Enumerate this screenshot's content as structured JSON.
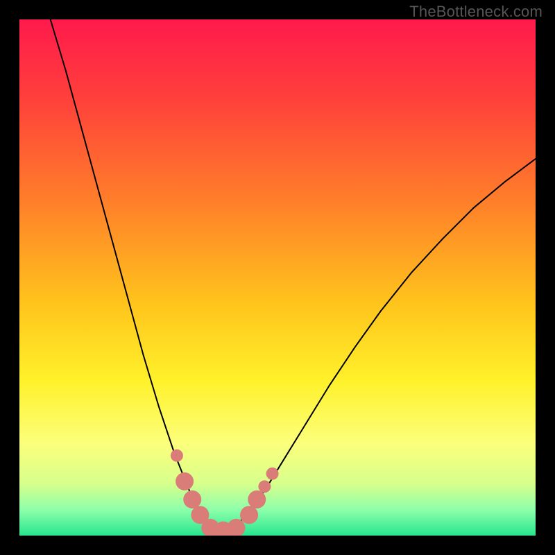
{
  "watermark": "TheBottleneck.com",
  "chart_data": {
    "type": "line",
    "title": "",
    "xlabel": "",
    "ylabel": "",
    "xlim": [
      0,
      1
    ],
    "ylim": [
      0,
      1
    ],
    "grid": false,
    "legend": false,
    "background_gradient": {
      "direction": "top-to-bottom",
      "stops": [
        {
          "t": 0.0,
          "color": "#ff1a4c"
        },
        {
          "t": 0.15,
          "color": "#ff3f3b"
        },
        {
          "t": 0.35,
          "color": "#ff7e2a"
        },
        {
          "t": 0.55,
          "color": "#ffc41c"
        },
        {
          "t": 0.7,
          "color": "#fff12a"
        },
        {
          "t": 0.82,
          "color": "#fcff7b"
        },
        {
          "t": 0.9,
          "color": "#d7ff8c"
        },
        {
          "t": 0.95,
          "color": "#8dffaa"
        },
        {
          "t": 1.0,
          "color": "#28e58f"
        }
      ]
    },
    "series": [
      {
        "name": "bottleneck-curve",
        "color": "#000000",
        "stroke_width": 2,
        "x": [
          0.06,
          0.09,
          0.12,
          0.15,
          0.18,
          0.21,
          0.24,
          0.27,
          0.3,
          0.32,
          0.34,
          0.355,
          0.37,
          0.385,
          0.4,
          0.42,
          0.45,
          0.48,
          0.52,
          0.56,
          0.6,
          0.65,
          0.7,
          0.76,
          0.82,
          0.88,
          0.94,
          1.0
        ],
        "values": [
          1.0,
          0.9,
          0.79,
          0.68,
          0.57,
          0.46,
          0.35,
          0.25,
          0.16,
          0.11,
          0.06,
          0.035,
          0.02,
          0.01,
          0.01,
          0.02,
          0.05,
          0.095,
          0.16,
          0.225,
          0.29,
          0.365,
          0.435,
          0.51,
          0.575,
          0.635,
          0.685,
          0.73
        ]
      }
    ],
    "markers": {
      "name": "highlight-points",
      "color": "#da7c78",
      "radius_small": 9,
      "radius_large": 13,
      "points": [
        {
          "x": 0.305,
          "y": 0.155,
          "r": "small"
        },
        {
          "x": 0.32,
          "y": 0.105,
          "r": "large"
        },
        {
          "x": 0.335,
          "y": 0.07,
          "r": "large"
        },
        {
          "x": 0.35,
          "y": 0.04,
          "r": "large"
        },
        {
          "x": 0.37,
          "y": 0.015,
          "r": "large"
        },
        {
          "x": 0.395,
          "y": 0.01,
          "r": "large"
        },
        {
          "x": 0.42,
          "y": 0.015,
          "r": "large"
        },
        {
          "x": 0.445,
          "y": 0.04,
          "r": "large"
        },
        {
          "x": 0.46,
          "y": 0.07,
          "r": "large"
        },
        {
          "x": 0.475,
          "y": 0.095,
          "r": "small"
        },
        {
          "x": 0.49,
          "y": 0.12,
          "r": "small"
        }
      ]
    }
  }
}
